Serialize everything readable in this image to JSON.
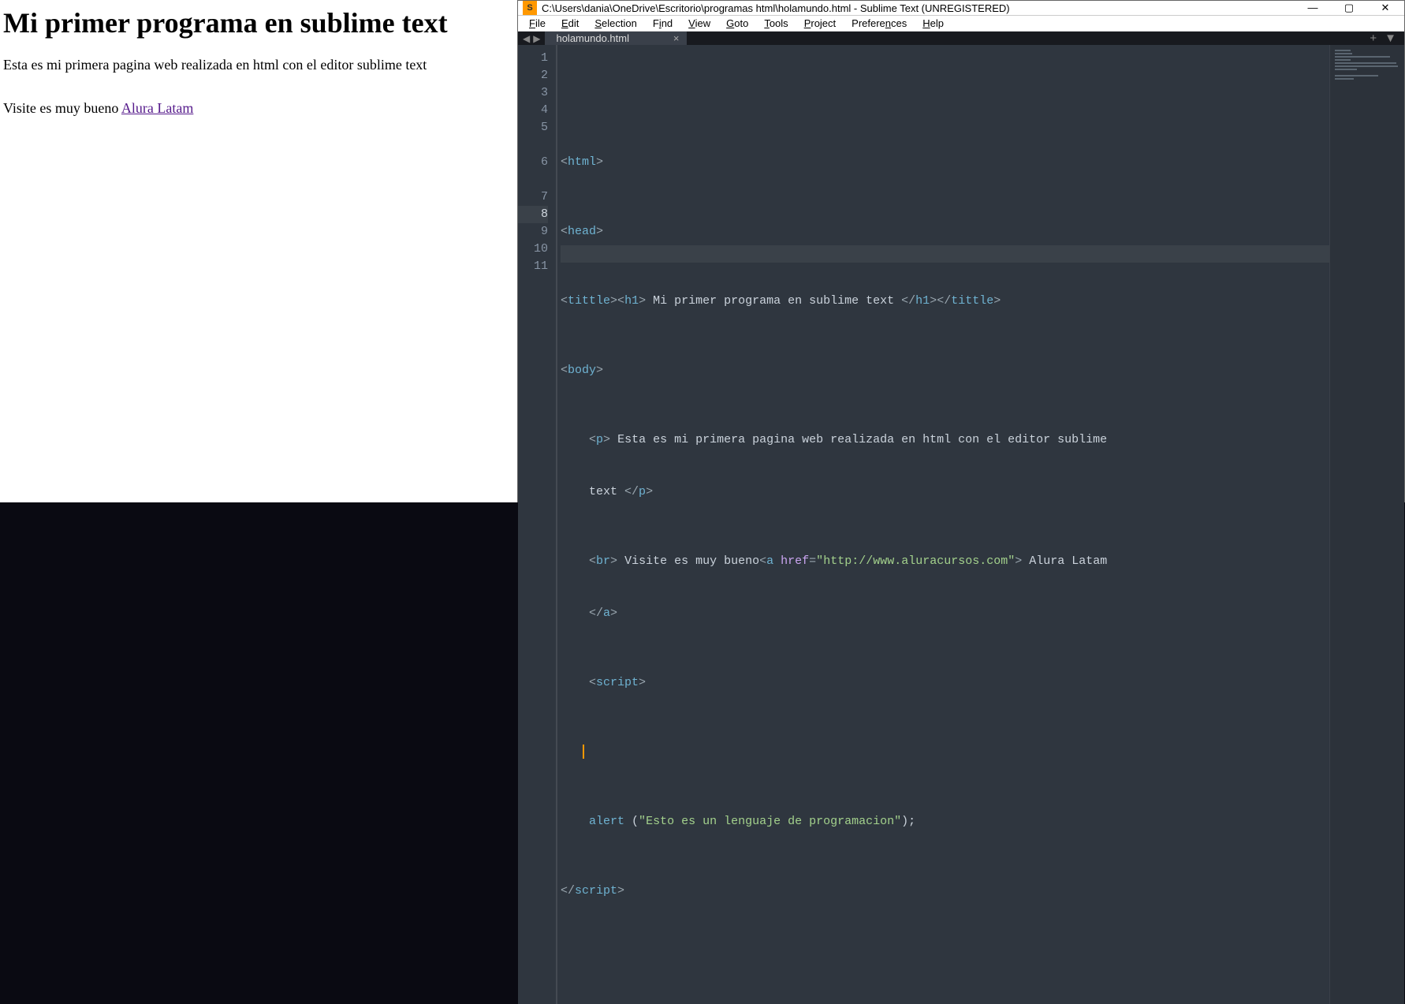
{
  "browser": {
    "heading": "Mi primer programa en sublime text",
    "paragraph": "Esta es mi primera pagina web realizada en html con el editor sublime text",
    "visit_prefix": "Visite es muy bueno ",
    "link_text": "Alura Latam"
  },
  "window": {
    "title": "C:\\Users\\dania\\OneDrive\\Escritorio\\programas html\\holamundo.html - Sublime Text (UNREGISTERED)",
    "app_icon_letter": "S"
  },
  "menu": {
    "file": "File",
    "edit": "Edit",
    "selection": "Selection",
    "find": "Find",
    "view": "View",
    "goto": "Goto",
    "tools": "Tools",
    "project": "Project",
    "preferences": "Preferences",
    "help": "Help"
  },
  "tabs": {
    "active": "holamundo.html"
  },
  "gutter": {
    "l1": "1",
    "l2": "2",
    "l3": "3",
    "l4": "4",
    "l5": "5",
    "l6": "6",
    "l7": "7",
    "l8": "8",
    "l9": "9",
    "l10": "10",
    "l11": "11"
  },
  "code": {
    "l1_tag_open": "<",
    "l1_tag": "html",
    "l1_tag_close": ">",
    "l2_tag_open": "<",
    "l2_tag": "head",
    "l2_tag_close": ">",
    "l3_t1_open": "<",
    "l3_t1": "tittle",
    "l3_t1_close": ">",
    "l3_t2_open": "<",
    "l3_t2": "h1",
    "l3_t2_close": ">",
    "l3_text": " Mi primer programa en sublime text ",
    "l3_t3_open": "</",
    "l3_t3": "h1",
    "l3_t3_close": ">",
    "l3_t4_open": "</",
    "l3_t4": "tittle",
    "l3_t4_close": ">",
    "l4_open": "<",
    "l4_tag": "body",
    "l4_close": ">",
    "l5_open": "<",
    "l5_tag": "p",
    "l5_close": ">",
    "l5_text": " Esta es mi primera pagina web realizada en html con el editor sublime ",
    "l5b_text": "text ",
    "l5b_open": "</",
    "l5b_tag": "p",
    "l5b_close": ">",
    "l6_open": "<",
    "l6_tag": "br",
    "l6_close": ">",
    "l6_text": " Visite es muy bueno",
    "l6_a_open": "<",
    "l6_a": "a",
    "l6_sp": " ",
    "l6_attr": "href",
    "l6_eq": "=",
    "l6_q": "\"",
    "l6_url": "http://www.aluracursos.com",
    "l6_q2": "\"",
    "l6_a_close": ">",
    "l6_after": " Alura Latam ",
    "l6b_open": "</",
    "l6b_tag": "a",
    "l6b_close": ">",
    "l7_open": "<",
    "l7_tag": "script",
    "l7_close": ">",
    "l9_func": "alert ",
    "l9_paren": "(",
    "l9_q": "\"",
    "l9_str": "Esto es un lenguaje de programacion",
    "l9_q2": "\"",
    "l9_paren2": ");",
    "l10_open": "</",
    "l10_tag": "script",
    "l10_close": ">"
  }
}
